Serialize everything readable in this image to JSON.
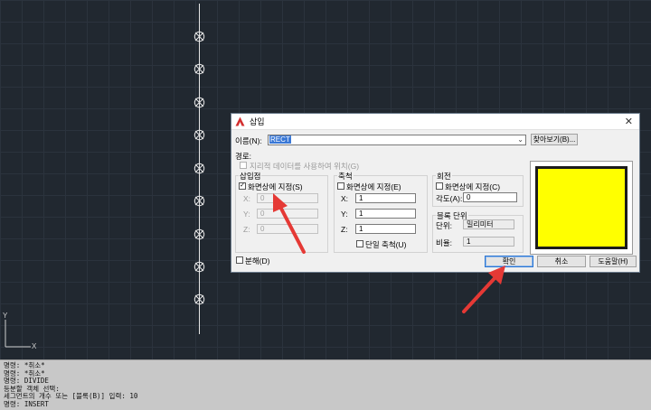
{
  "dialog": {
    "title": "삽입",
    "name_label": "이름(N):",
    "name_value": "RECT",
    "browse_button": "찾아보기(B)...",
    "path_label": "경로:",
    "geo_label": "지리적 데이터를 사용하여 위치(G)",
    "insertion": {
      "title": "삽입점",
      "onscreen_label": "화면상에 지정(S)",
      "onscreen_checked": "✓",
      "x_label": "X:",
      "y_label": "Y:",
      "z_label": "Z:",
      "x_value": "0",
      "y_value": "0",
      "z_value": "0"
    },
    "scale": {
      "title": "축척",
      "onscreen_label": "화면상에 지정(E)",
      "x_label": "X:",
      "y_label": "Y:",
      "z_label": "Z:",
      "x_value": "1",
      "y_value": "1",
      "z_value": "1",
      "uniform_label": "단일 축척(U)"
    },
    "rotation": {
      "title": "회전",
      "onscreen_label": "화면상에 지정(C)",
      "angle_label": "각도(A):",
      "angle_value": "0"
    },
    "block_unit": {
      "title": "블록 단위",
      "unit_label": "단위:",
      "unit_value": "밀리미터",
      "factor_label": "비율:",
      "factor_value": "1"
    },
    "explode_label": "분해(D)",
    "ok_button": "확인",
    "cancel_button": "취소",
    "help_button": "도움말(H)",
    "preview_color": "#ffff00"
  },
  "canvas": {
    "ucs_y": "Y",
    "ucs_x": "X"
  },
  "command_history": [
    "명령: *취소*",
    "명령: *취소*",
    "명령: DIVIDE",
    "등분할 객체 선택:",
    "세그먼트의 개수 또는 [블록(B)] 입력: 10",
    "명령: INSERT"
  ]
}
